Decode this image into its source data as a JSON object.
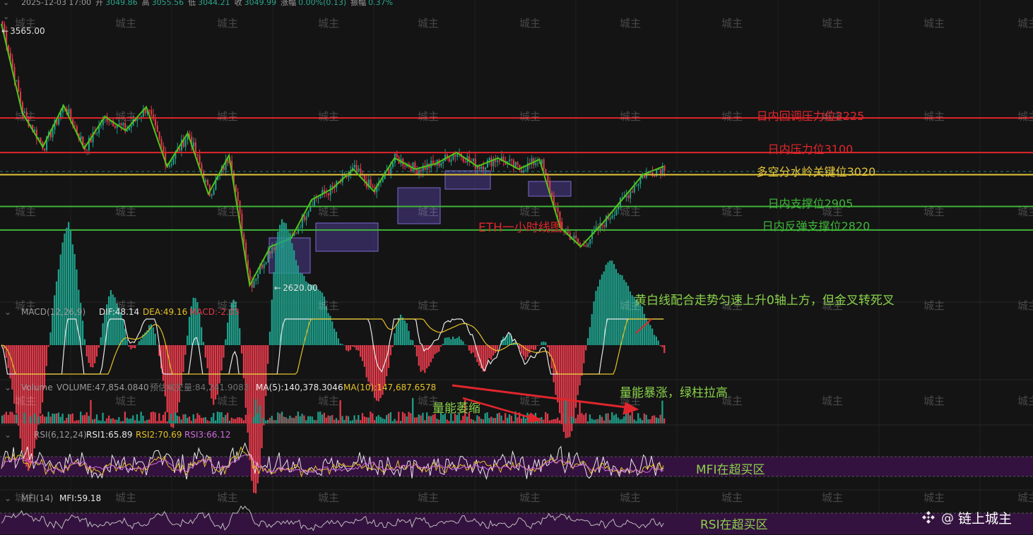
{
  "header": {
    "datetime": "2025-12-03 17:00",
    "open_label": "开",
    "open": "3049.86",
    "high_label": "高",
    "high": "3055.56",
    "low_label": "低",
    "low": "3044.21",
    "close_label": "收",
    "close": "3049.99",
    "change_label": "涨幅",
    "change": "0.00%(0.13)",
    "amp_label": "振幅",
    "amp": "0.37%"
  },
  "watermark": "城主",
  "brand": {
    "symbol": "@",
    "name": "链上城主"
  },
  "chart_data": [
    {
      "type": "candlestick",
      "title": "ETH一小时线图",
      "high_marker": "3565.00",
      "low_marker": "2620.00",
      "ylim": [
        2590,
        3575
      ],
      "levels": [
        {
          "label": "日内回调压力位3225",
          "value": 3225,
          "color": "#e0262c"
        },
        {
          "label": "日内压力位3100",
          "value": 3100,
          "color": "#e0262c"
        },
        {
          "label": "多空分水岭关键位3020",
          "value": 3020,
          "color": "#e2c43a"
        },
        {
          "label": "日内支撑位2905",
          "value": 2905,
          "color": "#3fb43a"
        },
        {
          "label": "日内反弹支撑位2820",
          "value": 2820,
          "color": "#3fb43a"
        }
      ],
      "last_price": 3049.99,
      "zigzag": [
        3565,
        3245,
        3120,
        3270,
        3115,
        3230,
        3180,
        3265,
        3050,
        3170,
        2950,
        3090,
        2620,
        2760,
        2790,
        2930,
        2970,
        3040,
        2960,
        3080,
        3040,
        3060,
        3100,
        3050,
        3080,
        3040,
        3075,
        2830,
        2760,
        2840,
        2930,
        3020,
        3050
      ]
    },
    {
      "type": "macd",
      "params": "MACD(12,26,9)",
      "dif": "DIF:48.14",
      "dea": "DEA:49.16",
      "macd": "MACD:-2.03",
      "annotation": "黄白线配合走势匀速上升0轴上方，但金叉转死叉"
    },
    {
      "type": "volume",
      "label": "Volume",
      "volume": "VOLUME:47,854.0840",
      "estimate": "预估成交量:84,241.9083",
      "ma5": "MA(5):140,378.3046",
      "ma10": "MA(10):147,687.6578",
      "annotation_shrink": "量能萎缩",
      "annotation_surge": "量能暴涨，绿柱拉高"
    },
    {
      "type": "rsi",
      "params": "RSI(6,12,24)",
      "rsi1": "RSI1:65.89",
      "rsi2": "RSI2:70.69",
      "rsi3": "RSI3:66.12",
      "annotation": "MFI在超买区"
    },
    {
      "type": "mfi",
      "params": "MFI(14)",
      "mfi": "MFI:59.18",
      "annotation": "RSI在超买区"
    }
  ],
  "colors": {
    "up": "#1f9f8a",
    "down": "#e23a4a",
    "zigzag": "#52c417",
    "box": "#4a3a8c",
    "white_line": "#e8e8e8",
    "yellow_line": "#e6c229",
    "purple_line": "#d16ae0",
    "purple_band": "#3a1246"
  }
}
